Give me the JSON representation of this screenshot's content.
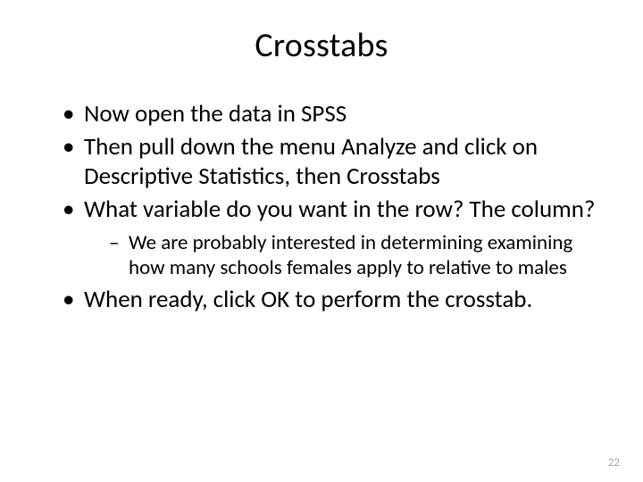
{
  "title": "Crosstabs",
  "bullets": [
    {
      "text": "Now open the data in SPSS"
    },
    {
      "text": "Then pull down the menu Analyze and click on Descriptive Statistics, then Crosstabs"
    },
    {
      "text": "What variable do you want in the row?  The column?",
      "sub": [
        {
          "text": "We are probably interested in determining examining how many schools females apply to relative to males"
        }
      ]
    },
    {
      "text": "When ready, click OK to perform the crosstab."
    }
  ],
  "page_number": "22"
}
